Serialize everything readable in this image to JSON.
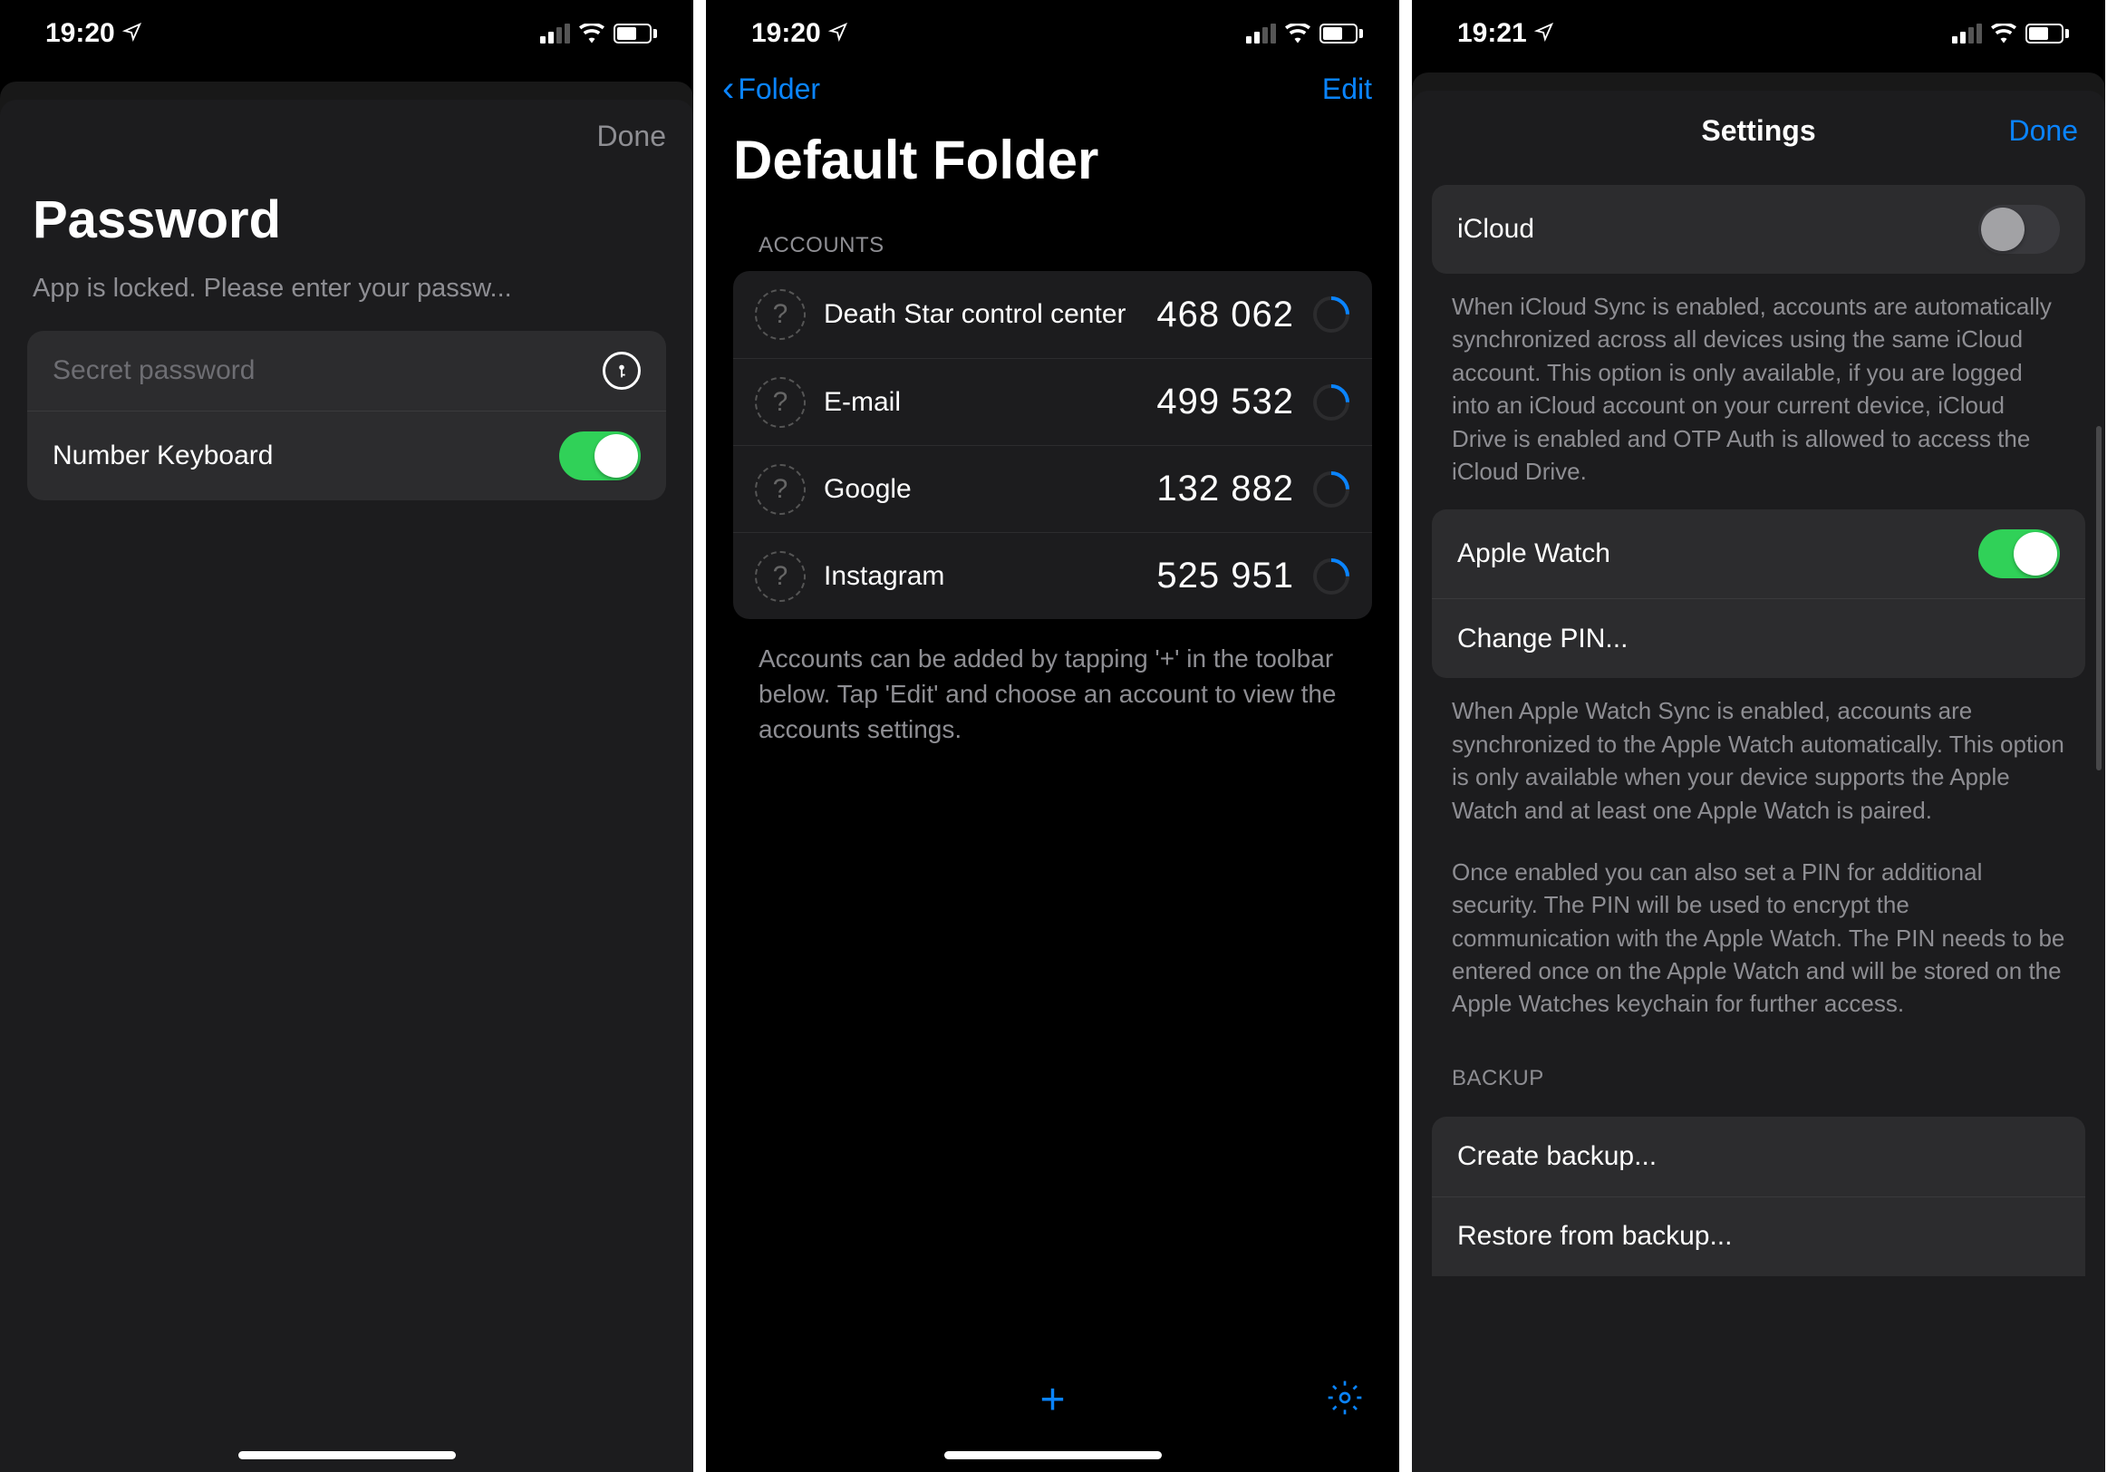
{
  "screen1": {
    "time": "19:20",
    "done": "Done",
    "title": "Password",
    "subtitle": "App is locked. Please enter your passw...",
    "placeholder": "Secret password",
    "number_keyboard_label": "Number Keyboard"
  },
  "screen2": {
    "time": "19:20",
    "back_label": "Folder",
    "edit_label": "Edit",
    "title": "Default Folder",
    "section": "ACCOUNTS",
    "accounts": [
      {
        "name": "Death Star control center",
        "code": "468 062"
      },
      {
        "name": "E-mail",
        "code": "499 532"
      },
      {
        "name": "Google",
        "code": "132 882"
      },
      {
        "name": "Instagram",
        "code": "525 951"
      }
    ],
    "footer": "Accounts can be added by tapping '+' in the toolbar below. Tap 'Edit' and choose an account to view the accounts settings."
  },
  "screen3": {
    "time": "19:21",
    "title": "Settings",
    "done": "Done",
    "icloud_label": "iCloud",
    "icloud_desc": "When iCloud Sync is enabled, accounts are automatically synchronized across all devices using the same iCloud account. This option is only available, if you are logged into an iCloud account on your current device, iCloud Drive is enabled and OTP Auth is allowed to access the iCloud Drive.",
    "apple_watch_label": "Apple Watch",
    "change_pin_label": "Change PIN...",
    "watch_desc1": "When Apple Watch Sync is enabled, accounts are synchronized to the Apple Watch automatically. This option is only available when your device supports the Apple Watch and at least one Apple Watch is paired.",
    "watch_desc2": "Once enabled you can also set a PIN for additional security. The PIN will be used to encrypt the communication with the Apple Watch. The PIN needs to be entered once on the Apple Watch and will be stored on the Apple Watches keychain for further access.",
    "backup_section": "BACKUP",
    "create_backup": "Create backup...",
    "restore_backup": "Restore from backup..."
  }
}
